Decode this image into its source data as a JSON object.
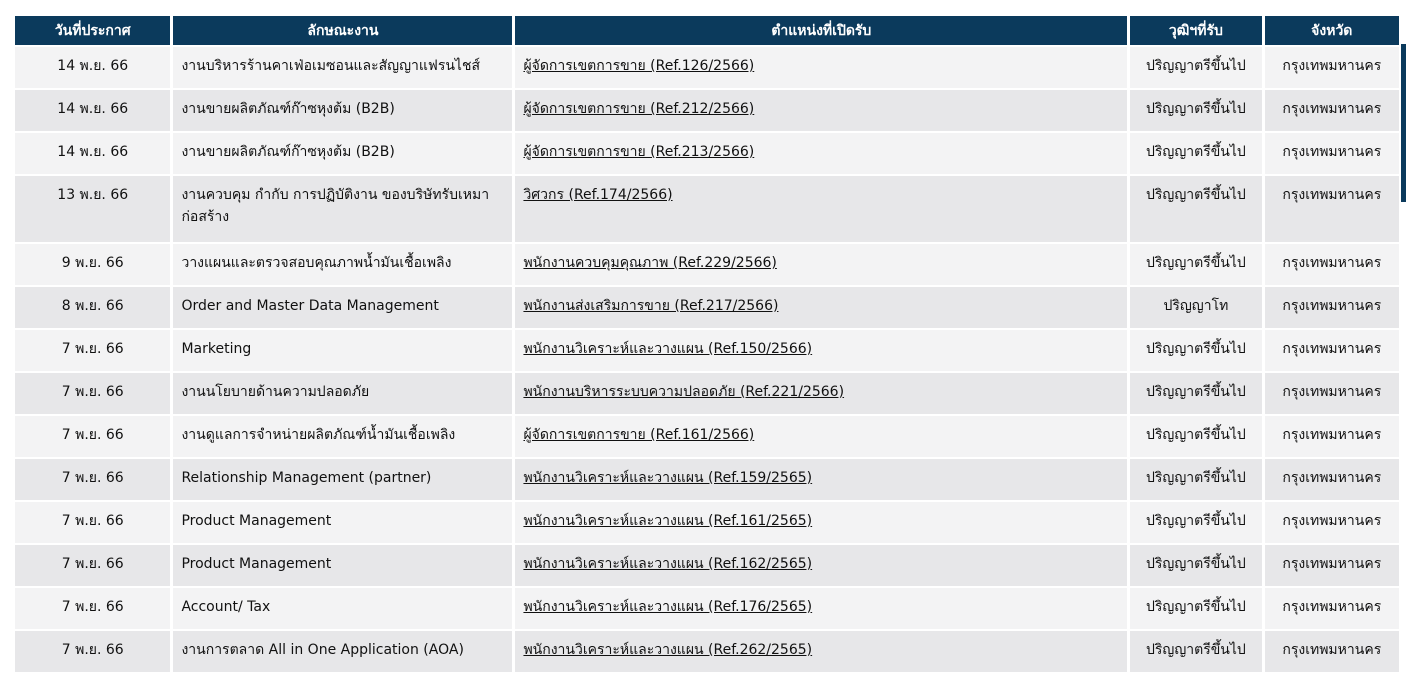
{
  "table": {
    "headers": {
      "date": "วันที่ประกาศ",
      "type": "ลักษณะงาน",
      "position": "ตำแหน่งที่เปิดรับ",
      "education": "วุฒิฯที่รับ",
      "province": "จังหวัด"
    },
    "rows": [
      {
        "date": "14 พ.ย. 66",
        "type": "งานบริหารร้านคาเฟ่อเมซอนและสัญญาแฟรนไชส์",
        "position": "ผู้จัดการเขตการขาย (Ref.126/2566)",
        "education": "ปริญญาตรีขึ้นไป",
        "province": "กรุงเทพมหานคร"
      },
      {
        "date": "14 พ.ย. 66",
        "type": "งานขายผลิตภัณฑ์ก๊าซหุงต้ม (B2B)",
        "position": "ผู้จัดการเขตการขาย (Ref.212/2566)",
        "education": "ปริญญาตรีขึ้นไป",
        "province": "กรุงเทพมหานคร"
      },
      {
        "date": "14 พ.ย. 66",
        "type": "งานขายผลิตภัณฑ์ก๊าซหุงต้ม (B2B)",
        "position": "ผู้จัดการเขตการขาย (Ref.213/2566)",
        "education": "ปริญญาตรีขึ้นไป",
        "province": "กรุงเทพมหานคร"
      },
      {
        "date": "13 พ.ย. 66",
        "type": "งานควบคุม กำกับ การปฏิบัติงาน ของบริษัทรับเหมาก่อสร้าง",
        "position": "วิศวกร (Ref.174/2566)",
        "education": "ปริญญาตรีขึ้นไป",
        "province": "กรุงเทพมหานคร"
      },
      {
        "date": "9 พ.ย. 66",
        "type": "วางแผนและตรวจสอบคุณภาพน้ำมันเชื้อเพลิง",
        "position": "พนักงานควบคุมคุณภาพ (Ref.229/2566)",
        "education": "ปริญญาตรีขึ้นไป",
        "province": "กรุงเทพมหานคร"
      },
      {
        "date": "8 พ.ย. 66",
        "type": "Order and Master Data Management",
        "position": "พนักงานส่งเสริมการขาย (Ref.217/2566)",
        "education": "ปริญญาโท",
        "province": "กรุงเทพมหานคร"
      },
      {
        "date": "7 พ.ย. 66",
        "type": "Marketing",
        "position": "พนักงานวิเคราะห์และวางแผน (Ref.150/2566)",
        "education": "ปริญญาตรีขึ้นไป",
        "province": "กรุงเทพมหานคร"
      },
      {
        "date": "7 พ.ย. 66",
        "type": "งานนโยบายด้านความปลอดภัย",
        "position": "พนักงานบริหารระบบความปลอดภัย (Ref.221/2566)",
        "education": "ปริญญาตรีขึ้นไป",
        "province": "กรุงเทพมหานคร"
      },
      {
        "date": "7 พ.ย. 66",
        "type": "งานดูแลการจำหน่ายผลิตภัณฑ์น้ำมันเชื้อเพลิง",
        "position": "ผู้จัดการเขตการขาย (Ref.161/2566)",
        "education": "ปริญญาตรีขึ้นไป",
        "province": "กรุงเทพมหานคร"
      },
      {
        "date": "7 พ.ย. 66",
        "type": "Relationship Management (partner)",
        "position": "พนักงานวิเคราะห์และวางแผน (Ref.159/2565)",
        "education": "ปริญญาตรีขึ้นไป",
        "province": "กรุงเทพมหานคร"
      },
      {
        "date": "7 พ.ย. 66",
        "type": "Product Management",
        "position": "พนักงานวิเคราะห์และวางแผน (Ref.161/2565)",
        "education": "ปริญญาตรีขึ้นไป",
        "province": "กรุงเทพมหานคร"
      },
      {
        "date": "7 พ.ย. 66",
        "type": "Product Management",
        "position": "พนักงานวิเคราะห์และวางแผน (Ref.162/2565)",
        "education": "ปริญญาตรีขึ้นไป",
        "province": "กรุงเทพมหานคร"
      },
      {
        "date": "7 พ.ย. 66",
        "type": "Account/ Tax",
        "position": "พนักงานวิเคราะห์และวางแผน (Ref.176/2565)",
        "education": "ปริญญาตรีขึ้นไป",
        "province": "กรุงเทพมหานคร"
      },
      {
        "date": "7 พ.ย. 66",
        "type": "งานการตลาด All in One Application (AOA)",
        "position": "พนักงานวิเคราะห์และวางแผน (Ref.262/2565)",
        "education": "ปริญญาตรีขึ้นไป",
        "province": "กรุงเทพมหานคร"
      }
    ]
  },
  "colors": {
    "header_bg": "#0b3a5c",
    "row_light": "#f3f3f4",
    "row_dark": "#e7e7e9"
  }
}
